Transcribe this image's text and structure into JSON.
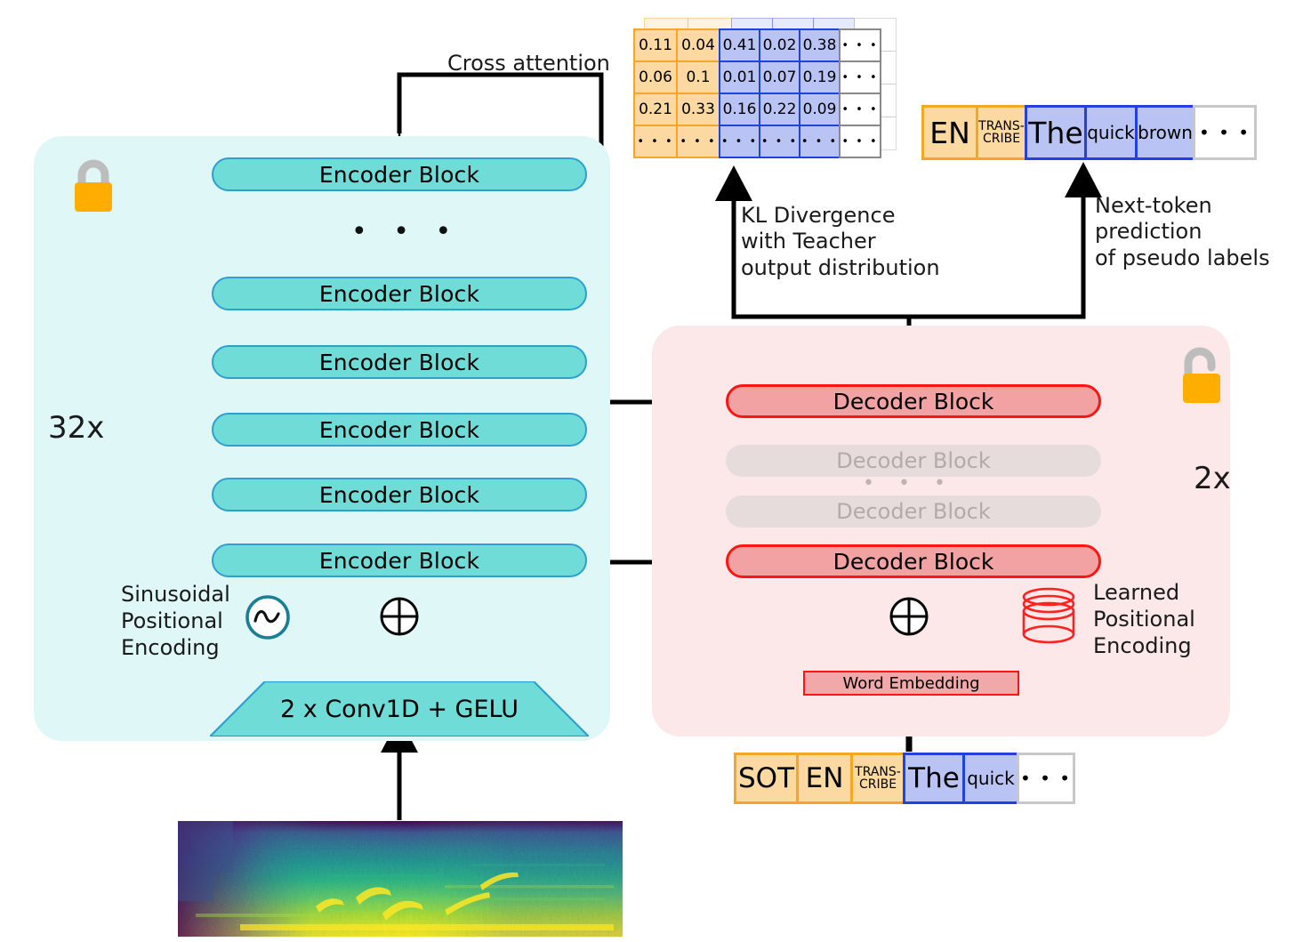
{
  "diagram": {
    "title": "Knowledge distillation architecture: Whisper teacher encoder to student decoder"
  },
  "encoder": {
    "panel_color": "#dff7f7",
    "block_color": "#6fdcd8",
    "block_border": "#2f9fd0",
    "lock_icon": "locked-padlock-icon",
    "repeat_label": "32x",
    "blocks": [
      {
        "label": "Encoder Block"
      },
      {
        "label": "Encoder Block"
      },
      {
        "label": "Encoder Block"
      },
      {
        "label": "Encoder Block"
      },
      {
        "label": "Encoder Block"
      },
      {
        "label": "Encoder Block"
      }
    ],
    "ellipsis": "• • •",
    "positional_encoding": {
      "label": "Sinusoidal\nPositional\nEncoding",
      "icon": "sine-wave-icon",
      "glyph": "∿"
    },
    "frontend": {
      "label": "2 x Conv1D + GELU"
    },
    "add_icon": "plus-circle-icon"
  },
  "decoder": {
    "panel_color": "#fce8e8",
    "block_color": "#f2a2a2",
    "block_border": "#ff1414",
    "lock_icon": "unlocked-padlock-icon",
    "repeat_label": "2x",
    "blocks": [
      {
        "label": "Decoder Block",
        "state": "active"
      },
      {
        "label": "Decoder Block",
        "state": "faded"
      },
      {
        "label": "Decoder Block",
        "state": "faded"
      },
      {
        "label": "Decoder Block",
        "state": "active"
      }
    ],
    "ellipsis": "• • •",
    "word_embedding": {
      "label": "Word Embedding"
    },
    "positional_encoding": {
      "label": "Learned\nPositional\nEncoding",
      "icon": "database-cylinder-icon"
    },
    "add_icon": "plus-circle-icon"
  },
  "annotations": {
    "cross_attention": "Cross attention",
    "kl_divergence": "KL Divergence\nwith Teacher\noutput distribution",
    "next_token": "Next-token\nprediction\nof pseudo labels"
  },
  "probability_matrix": {
    "rows": [
      [
        "0.11",
        "0.04",
        "0.41",
        "0.02",
        "0.38",
        "• • •"
      ],
      [
        "0.06",
        "0.1",
        "0.01",
        "0.07",
        "0.19",
        "• • •"
      ],
      [
        "0.21",
        "0.33",
        "0.16",
        "0.22",
        "0.09",
        "• • •"
      ],
      [
        "• • •",
        "• • •",
        "• • •",
        "• • •",
        "• • •",
        "• • •"
      ]
    ],
    "column_kinds": [
      "orange",
      "orange",
      "blue",
      "blue",
      "blue",
      "grey"
    ]
  },
  "output_tokens": {
    "tokens": [
      {
        "text": "EN",
        "kind": "orange",
        "size": "lg"
      },
      {
        "text": "TRANS-\nCRIBE",
        "kind": "orange",
        "size": "sm"
      },
      {
        "text": "The",
        "kind": "blue",
        "size": "lg"
      },
      {
        "text": "quick",
        "kind": "blue",
        "size": "md"
      },
      {
        "text": "brown",
        "kind": "blue",
        "size": "md"
      },
      {
        "text": "• • •",
        "kind": "grey",
        "size": "md"
      }
    ]
  },
  "input_tokens": {
    "tokens": [
      {
        "text": "SOT",
        "kind": "orange",
        "size": "lg"
      },
      {
        "text": "EN",
        "kind": "orange",
        "size": "lg"
      },
      {
        "text": "TRANS-\nCRIBE",
        "kind": "orange",
        "size": "sm"
      },
      {
        "text": "The",
        "kind": "blue",
        "size": "lg"
      },
      {
        "text": "quick",
        "kind": "blue",
        "size": "md"
      },
      {
        "text": "• • •",
        "kind": "grey",
        "size": "md"
      }
    ]
  },
  "spectrogram": {
    "name": "mel-spectrogram",
    "colormap": "viridis"
  },
  "colors": {
    "encoder_panel": "#dff7f7",
    "encoder_block": "#6fdcd8",
    "decoder_panel": "#fce8e8",
    "decoder_block": "#f2a2a2",
    "token_orange": "#fcd9a0",
    "token_orange_border": "#f5a623",
    "token_blue": "#b9c4f5",
    "token_blue_border": "#2540e0",
    "lock_gold": "#ffae00",
    "arrow_black": "#000000"
  }
}
